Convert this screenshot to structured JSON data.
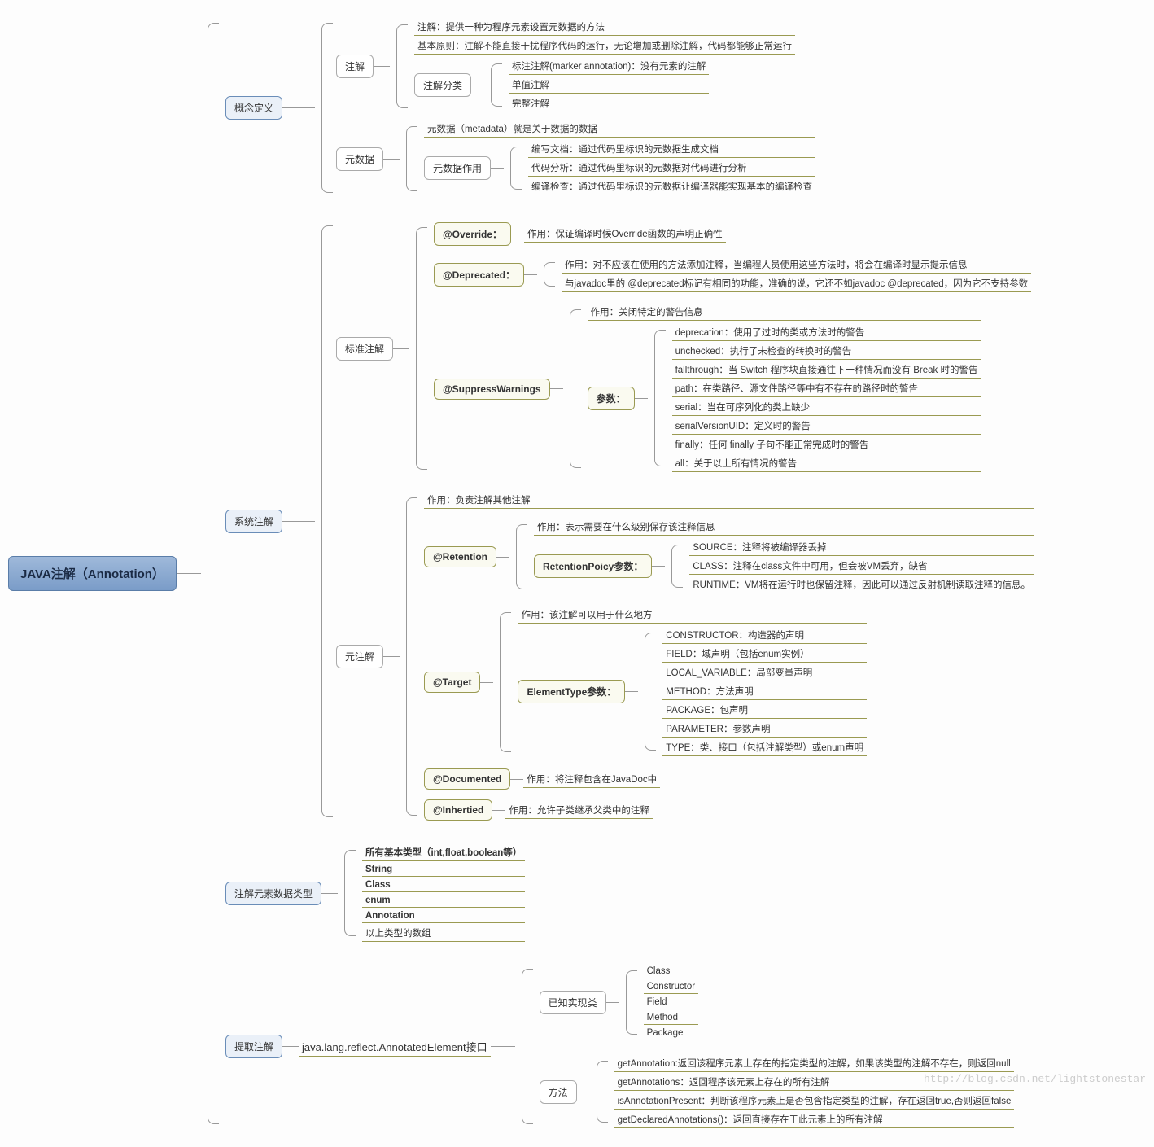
{
  "root": "JAVA注解（Annotation）",
  "watermark": "http://blog.csdn.net/lightstonestar",
  "b1": {
    "label": "概念定义",
    "n1": {
      "label": "注解",
      "l1": "注解：提供一种为程序元素设置元数据的方法",
      "l2": "基本原则：注解不能直接干扰程序代码的运行，无论增加或删除注解，代码都能够正常运行",
      "sub": {
        "label": "注解分类",
        "l1": "标注注解(marker annotation)：没有元素的注解",
        "l2": "单值注解",
        "l3": "完整注解"
      }
    },
    "n2": {
      "label": "元数据",
      "l1": "元数据（metadata）就是关于数据的数据",
      "sub": {
        "label": "元数据作用",
        "l1": "编写文档：通过代码里标识的元数据生成文档",
        "l2": "代码分析：通过代码里标识的元数据对代码进行分析",
        "l3": "编译检查：通过代码里标识的元数据让编译器能实现基本的编译检查"
      }
    }
  },
  "b2": {
    "label": "系统注解",
    "n1": {
      "label": "标准注解",
      "s1": {
        "label": "@Override：",
        "l1": "作用：保证编译时候Override函数的声明正确性"
      },
      "s2": {
        "label": "@Deprecated：",
        "l1": "作用：对不应该在使用的方法添加注释，当编程人员使用这些方法时，将会在编译时显示提示信息",
        "l2": "与javadoc里的 @deprecated标记有相同的功能，准确的说，它还不如javadoc  @deprecated，因为它不支持参数"
      },
      "s3": {
        "label": "@SuppressWarnings",
        "l1": "作用：关闭特定的警告信息",
        "params": {
          "label": "参数：",
          "l1": "deprecation：使用了过时的类或方法时的警告",
          "l2": "unchecked：执行了未检查的转换时的警告",
          "l3": "fallthrough：当 Switch 程序块直接通往下一种情况而没有 Break 时的警告",
          "l4": "path：在类路径、源文件路径等中有不存在的路径时的警告",
          "l5": "serial：当在可序列化的类上缺少",
          "l6": "serialVersionUID：定义时的警告",
          "l7": "finally：任何 finally 子句不能正常完成时的警告",
          "l8": "all：关于以上所有情况的警告"
        }
      }
    },
    "n2": {
      "label": "元注解",
      "l0": "作用：负责注解其他注解",
      "s1": {
        "label": "@Retention",
        "l1": "作用：表示需要在什么级别保存该注释信息",
        "params": {
          "label": "RetentionPoicy参数：",
          "l1": "SOURCE：注释将被编译器丢掉",
          "l2": "CLASS：注释在class文件中可用，但会被VM丢弃，缺省",
          "l3": "RUNTIME：VM将在运行时也保留注释，因此可以通过反射机制读取注释的信息。"
        }
      },
      "s2": {
        "label": "@Target",
        "l1": "作用：该注解可以用于什么地方",
        "params": {
          "label": "ElementType参数：",
          "l1": "CONSTRUCTOR：构造器的声明",
          "l2": "FIELD：域声明（包括enum实例）",
          "l3": "LOCAL_VARIABLE：局部变量声明",
          "l4": "METHOD：方法声明",
          "l5": "PACKAGE：包声明",
          "l6": "PARAMETER：参数声明",
          "l7": "TYPE：类、接口（包括注解类型）或enum声明"
        }
      },
      "s3": {
        "label": "@Documented",
        "l1": "作用：将注释包含在JavaDoc中"
      },
      "s4": {
        "label": "@Inhertied",
        "l1": "作用：允许子类继承父类中的注释"
      }
    }
  },
  "b3": {
    "label": "注解元素数据类型",
    "l1": "所有基本类型（int,float,boolean等）",
    "l2": "String",
    "l3": "Class",
    "l4": "enum",
    "l5": "Annotation",
    "l6": "以上类型的数组"
  },
  "b4": {
    "label": "提取注解",
    "l1": "java.lang.reflect.AnnotatedElement接口",
    "s1": {
      "label": "已知实现类",
      "l1": "Class",
      "l2": "Constructor",
      "l3": "Field",
      "l4": "Method",
      "l5": "Package"
    },
    "s2": {
      "label": "方法",
      "l1": "getAnnotation:返回该程序元素上存在的指定类型的注解，如果该类型的注解不存在，则返回null",
      "l2": "getAnnotations：返回程序该元素上存在的所有注解",
      "l3": "isAnnotationPresent：判断该程序元素上是否包含指定类型的注解，存在返回true,否则返回false",
      "l4": "getDeclaredAnnotations()：返回直接存在于此元素上的所有注解"
    }
  }
}
